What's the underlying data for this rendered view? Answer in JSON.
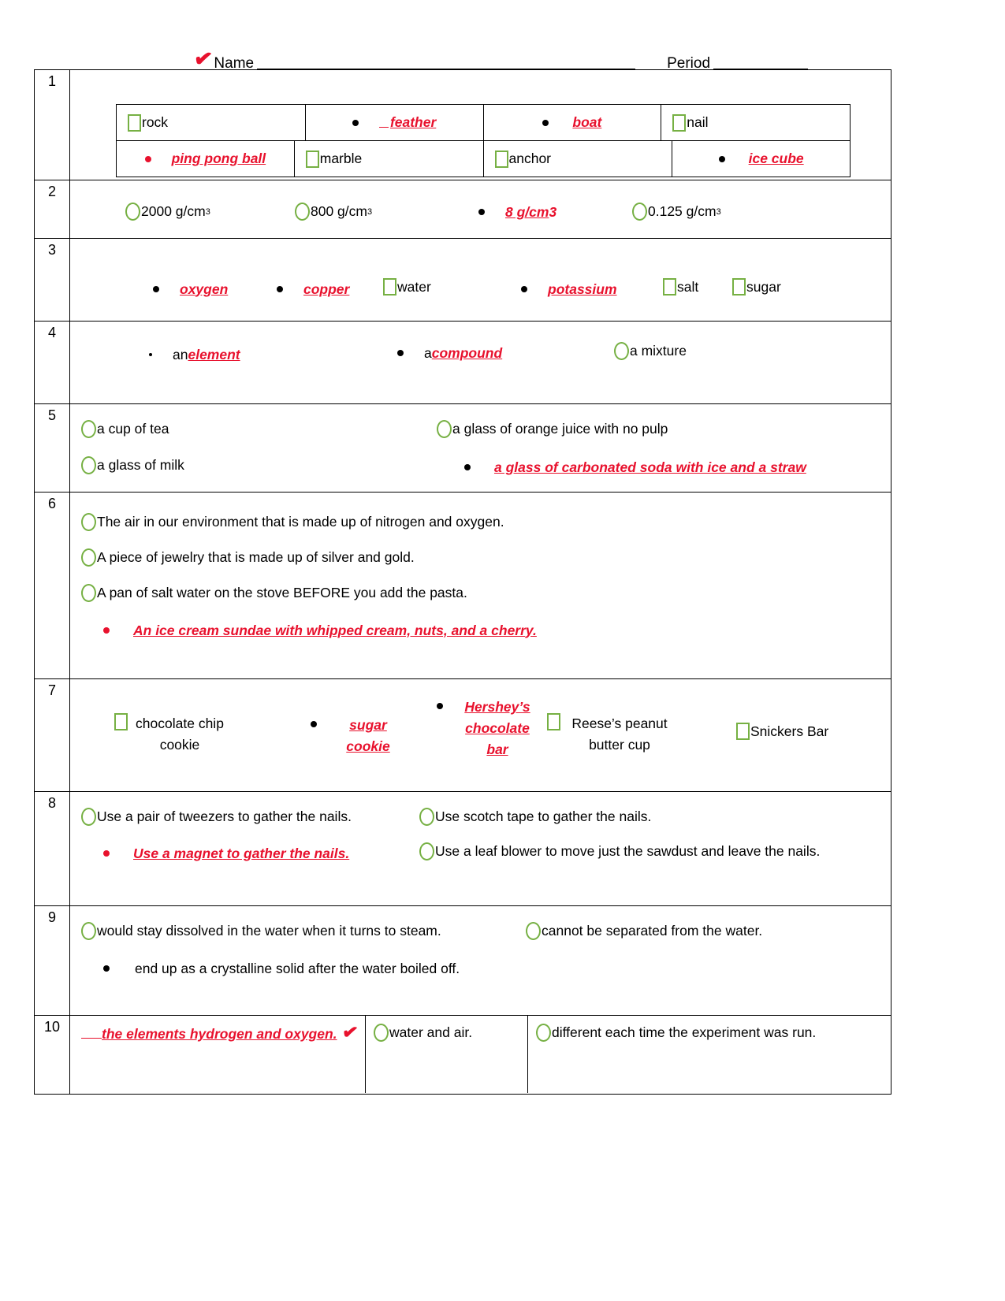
{
  "header": {
    "check_mark": "✔",
    "name_label": "Name",
    "period_label": "Period"
  },
  "questions": [
    {
      "number": "1",
      "layout": "grid-2x4",
      "cells": [
        {
          "label": "rock",
          "control": "checkbox",
          "selected": false
        },
        {
          "label": "feather",
          "control": "bullet",
          "selected": true,
          "bullet_color": "black",
          "lead_dash": true
        },
        {
          "label": "boat",
          "control": "bullet",
          "selected": true,
          "bullet_color": "black"
        },
        {
          "label": "nail",
          "control": "checkbox",
          "selected": false
        },
        {
          "label": "ping pong ball",
          "control": "bullet",
          "selected": true,
          "bullet_color": "red"
        },
        {
          "label": "marble",
          "control": "checkbox",
          "selected": false
        },
        {
          "label": "anchor",
          "control": "checkbox",
          "selected": false
        },
        {
          "label": "ice cube",
          "control": "bullet",
          "selected": true,
          "bullet_color": "black"
        }
      ]
    },
    {
      "number": "2",
      "layout": "inline",
      "options": [
        {
          "label": "2000 g/cm",
          "sup": "3",
          "control": "radio",
          "selected": false
        },
        {
          "label": "800 g/cm",
          "sup": "3",
          "control": "radio",
          "selected": false
        },
        {
          "label": "8 g/cm",
          "sup": "3",
          "control": "bullet",
          "selected": true,
          "bullet_color": "black"
        },
        {
          "label": "0.125 g/cm",
          "sup": "3",
          "control": "radio",
          "selected": false
        }
      ]
    },
    {
      "number": "3",
      "layout": "inline",
      "options": [
        {
          "label": "oxygen",
          "control": "bullet",
          "selected": true,
          "bullet_color": "black"
        },
        {
          "label": "copper",
          "control": "bullet",
          "selected": true,
          "bullet_color": "black"
        },
        {
          "label": "water",
          "control": "checkbox",
          "selected": false
        },
        {
          "label": "potassium",
          "control": "bullet",
          "selected": true,
          "bullet_color": "black"
        },
        {
          "label": "salt",
          "control": "checkbox",
          "selected": false
        },
        {
          "label": "sugar",
          "control": "checkbox",
          "selected": false
        }
      ]
    },
    {
      "number": "4",
      "layout": "inline",
      "options": [
        {
          "prefix": "an ",
          "label": "element",
          "control": "bullet-tiny",
          "selected": true,
          "bullet_color": "black"
        },
        {
          "prefix": "a ",
          "label": "compound",
          "control": "bullet",
          "selected": true,
          "bullet_color": "black"
        },
        {
          "label": "a mixture",
          "control": "radio",
          "selected": false
        }
      ]
    },
    {
      "number": "5",
      "layout": "two-column-two-row",
      "options": [
        {
          "label": "a cup of tea",
          "control": "radio",
          "selected": false
        },
        {
          "label": "a glass of orange juice with no pulp",
          "control": "radio",
          "selected": false
        },
        {
          "label": "a glass of milk",
          "control": "radio",
          "selected": false
        },
        {
          "label": "a glass of carbonated soda with ice and a straw",
          "control": "bullet",
          "selected": true,
          "bullet_color": "black"
        }
      ]
    },
    {
      "number": "6",
      "layout": "stacked",
      "options": [
        {
          "label": "The air in our environment that is made up of nitrogen and oxygen.",
          "control": "radio",
          "selected": false
        },
        {
          "label": "A piece of jewelry that is made up of silver and gold.",
          "control": "radio",
          "selected": false
        },
        {
          "label": "A pan of salt water on the stove BEFORE you add the pasta.",
          "control": "radio",
          "selected": false
        },
        {
          "label": "An ice cream sundae with whipped cream, nuts, and a cherry.",
          "control": "bullet",
          "selected": true,
          "bullet_color": "red"
        }
      ]
    },
    {
      "number": "7",
      "layout": "inline-wrapped",
      "options": [
        {
          "label": "chocolate chip cookie",
          "control": "checkbox",
          "selected": false
        },
        {
          "label": "sugar cookie",
          "control": "bullet",
          "selected": true,
          "bullet_color": "black"
        },
        {
          "label": "Hershey’s chocolate bar",
          "control": "bullet",
          "selected": true,
          "bullet_color": "black"
        },
        {
          "label": "Reese’s peanut butter cup",
          "control": "checkbox",
          "selected": false
        },
        {
          "label": "Snickers Bar",
          "control": "checkbox",
          "selected": false
        }
      ]
    },
    {
      "number": "8",
      "layout": "two-column-two-row",
      "options": [
        {
          "label": "Use a pair of tweezers to gather the nails.",
          "control": "radio",
          "selected": false
        },
        {
          "label": "Use scotch tape to gather the nails.",
          "control": "radio",
          "selected": false
        },
        {
          "label": "Use a magnet to gather the nails.",
          "control": "bullet",
          "selected": true,
          "bullet_color": "red"
        },
        {
          "label": "Use a leaf blower to move just the sawdust and leave the nails.",
          "control": "radio",
          "selected": false
        }
      ]
    },
    {
      "number": "9",
      "layout": "two-column-two-row",
      "options": [
        {
          "label": "would stay dissolved in the water when it turns to steam.",
          "control": "radio",
          "selected": false
        },
        {
          "label": "cannot be separated from the water.",
          "control": "radio",
          "selected": false
        },
        {
          "label": "end up as a crystalline solid after the water boiled off.",
          "control": "bullet",
          "selected": true,
          "bullet_color": "black",
          "answer_style": "plain"
        }
      ]
    },
    {
      "number": "10",
      "layout": "three-cells",
      "options": [
        {
          "label": "the elements hydrogen and oxygen.",
          "control": "none",
          "selected": true,
          "check_mark": "✔"
        },
        {
          "label": "water and air.",
          "control": "radio",
          "selected": false
        },
        {
          "label": "different each time the experiment was run.",
          "control": "radio",
          "selected": false
        }
      ]
    }
  ]
}
